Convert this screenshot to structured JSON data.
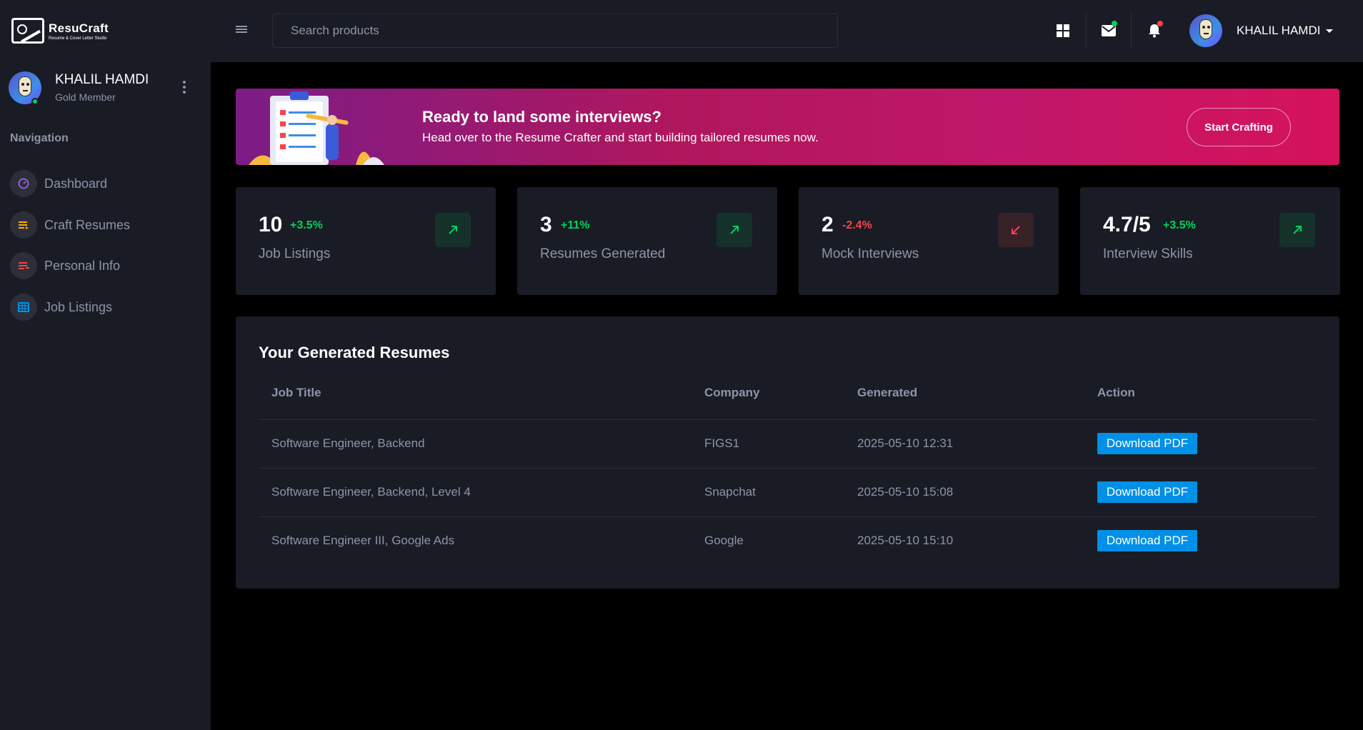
{
  "app": {
    "name": "ResuCraft",
    "tagline": "Resume & Cover Letter Studio",
    "accent": "#0090e7",
    "success": "#00d25b",
    "danger": "#fc424a"
  },
  "header": {
    "search_placeholder": "Search products",
    "icons": [
      "grid-icon",
      "mail-icon",
      "bell-icon"
    ],
    "user_name": "KHALIL HAMDI"
  },
  "sidebar": {
    "user_name": "KHALIL HAMDI",
    "membership": "Gold Member",
    "heading": "Navigation",
    "items": [
      {
        "label": "Dashboard",
        "icon": "speedometer-icon",
        "color": "#8f5fe8"
      },
      {
        "label": "Craft Resumes",
        "icon": "list-icon",
        "color": "#ffab00"
      },
      {
        "label": "Personal Info",
        "icon": "playlist-icon",
        "color": "#fc424a"
      },
      {
        "label": "Job Listings",
        "icon": "table-icon",
        "color": "#0090e7"
      }
    ]
  },
  "banner": {
    "title": "Ready to land some interviews?",
    "subtitle": "Head over to the Resume Crafter and start building tailored resumes now.",
    "button": "Start Crafting"
  },
  "stats": [
    {
      "value": "10",
      "change": "+3.5%",
      "label": "Job Listings",
      "trend": "up"
    },
    {
      "value": "3",
      "change": "+11%",
      "label": "Resumes Generated",
      "trend": "up"
    },
    {
      "value": "2",
      "change": "-2.4%",
      "label": "Mock Interviews",
      "trend": "down"
    },
    {
      "value": "4.7/5",
      "change": "+3.5%",
      "label": "Interview Skills",
      "trend": "up"
    }
  ],
  "resumes": {
    "title": "Your Generated Resumes",
    "columns": [
      "Job Title",
      "Company",
      "Generated",
      "Action"
    ],
    "rows": [
      {
        "job_title": "Software Engineer, Backend",
        "company": "FIGS1",
        "generated": "2025-05-10 12:31",
        "action": "Download PDF"
      },
      {
        "job_title": "Software Engineer, Backend, Level 4",
        "company": "Snapchat",
        "generated": "2025-05-10 15:08",
        "action": "Download PDF"
      },
      {
        "job_title": "Software Engineer III, Google Ads",
        "company": "Google",
        "generated": "2025-05-10 15:10",
        "action": "Download PDF"
      }
    ]
  }
}
